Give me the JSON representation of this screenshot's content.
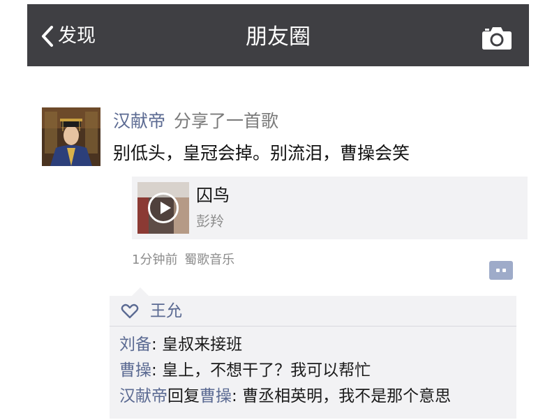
{
  "navbar": {
    "back_label": "发现",
    "title": "朋友圈",
    "back_icon": "chevron-left-icon",
    "camera_icon": "camera-icon"
  },
  "post": {
    "author": "汉献帝",
    "share_text": "分享了一首歌",
    "text": "别低头，皇冠会掉。别流泪，曹操会笑",
    "music": {
      "title": "囚鸟",
      "artist": "彭羚"
    },
    "time": "1分钟前",
    "source": "蜀歌音乐"
  },
  "likes": {
    "names": "王允"
  },
  "comments": [
    {
      "author": "刘备",
      "sep": ": ",
      "text": "皇叔来接班"
    },
    {
      "author": "曹操",
      "sep": ": ",
      "text": "皇上，不想干了？我可以帮忙"
    },
    {
      "author": "汉献帝",
      "reply_word": "回复",
      "reply_to": "曹操",
      "sep": ": ",
      "text": "曹丞相英明，我不是那个意思"
    }
  ],
  "colors": {
    "navbar_bg": "#3f3f43",
    "name_link": "#5b6a92",
    "panel_bg": "#f2f2f4",
    "comment_button": "#9eabc9"
  }
}
